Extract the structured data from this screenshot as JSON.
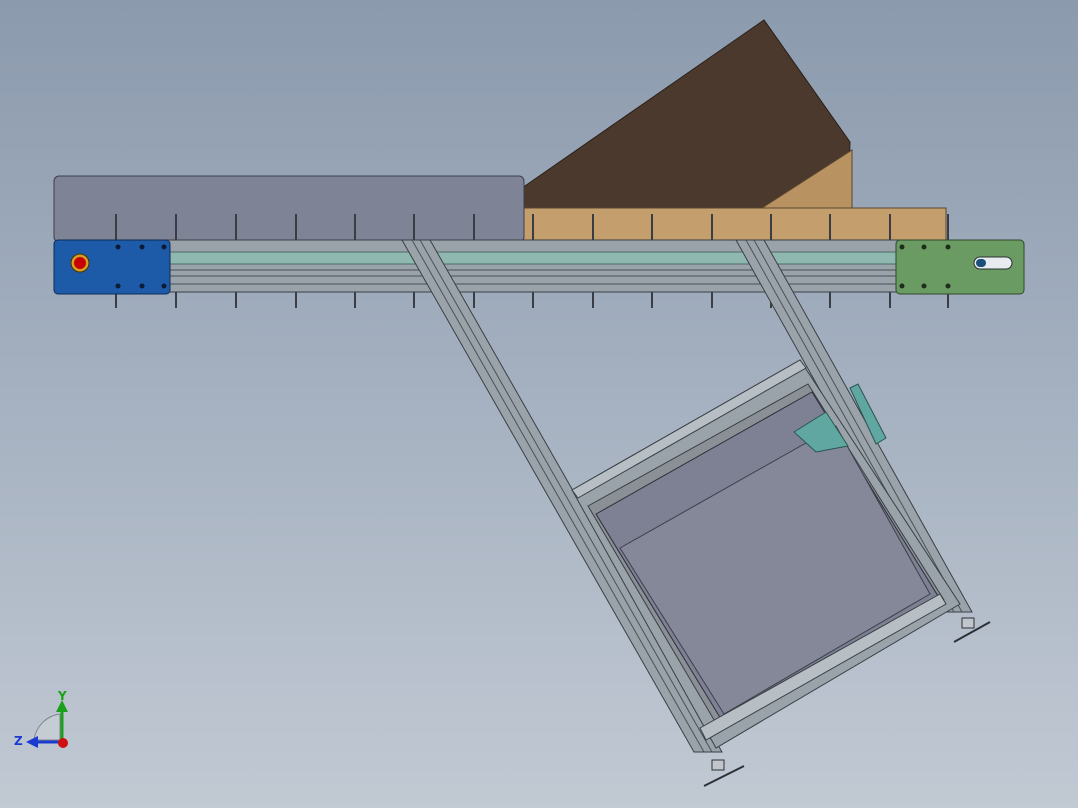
{
  "viewport": {
    "background_top": "#8b9aad",
    "background_bottom": "#c1c9d3"
  },
  "model": {
    "conveyor_frame_color": "#9aa3aa",
    "conveyor_belt_color": "#8fb8b1",
    "side_guard_color": "#7f8396",
    "hopper_dark_color": "#4a392c",
    "hopper_light_color": "#c49f6d",
    "left_endcap_color": "#1d5aa8",
    "right_endcap_color": "#6a9b62",
    "stop_button_color": "#c80000",
    "cart_tray_color": "#7d8193",
    "bracket_color": "#5fa7a0"
  },
  "triad": {
    "y_label": "Y",
    "z_label": "Z",
    "y_color": "#1aa01a",
    "z_color": "#1a3ad0",
    "x_color": "#d01010",
    "icons": [
      "coordinate-triad-icon"
    ]
  }
}
